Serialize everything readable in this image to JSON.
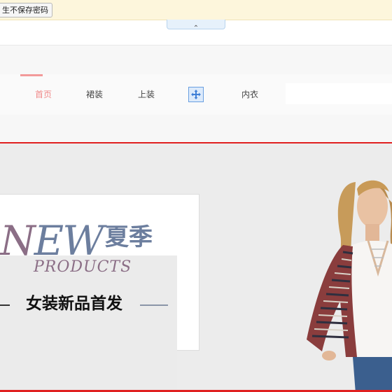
{
  "password_bar": {
    "button_label": "生不保存密码"
  },
  "nav": {
    "items": [
      {
        "label": "首页",
        "active": true
      },
      {
        "label": "裙装",
        "active": false
      },
      {
        "label": "上装",
        "active": false
      },
      {
        "label": "",
        "active": false
      },
      {
        "label": "内衣",
        "active": false
      }
    ]
  },
  "banner": {
    "new_word_n": "N",
    "new_word_ew": "EW",
    "season": "夏季",
    "products": "PRODUCTS",
    "tagline": "女装新品首发"
  },
  "colors": {
    "accent": "#f08a8a",
    "banner_border": "#e02020",
    "title_mauve": "#8b6e86",
    "title_blue": "#6c7e9e"
  }
}
